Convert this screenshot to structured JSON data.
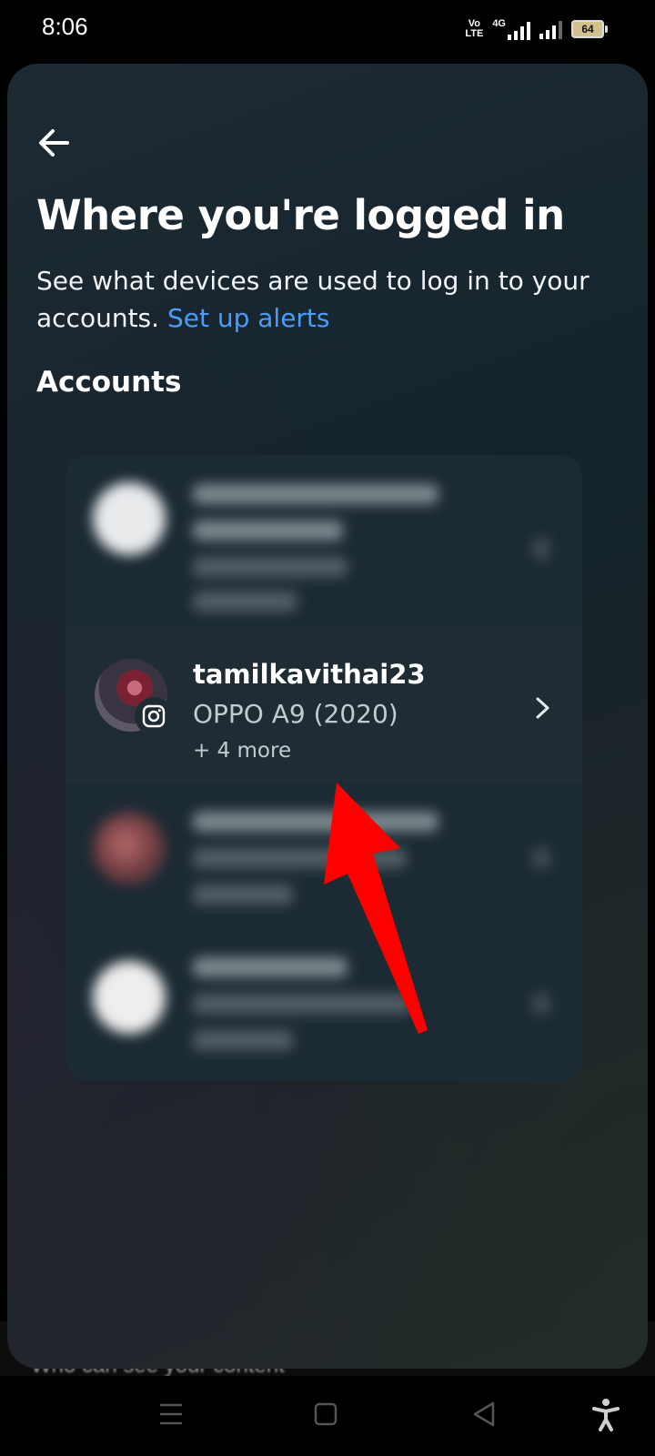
{
  "status_bar": {
    "time": "8:06",
    "volte_label": "Vo\nLTE",
    "network_label": "4G",
    "battery_level": "64"
  },
  "header": {
    "title": "Where you're logged in",
    "subtitle": "See what devices are used to log in to your accounts.",
    "alerts_link": "Set up alerts"
  },
  "accounts": {
    "heading": "Accounts",
    "highlighted": {
      "username": "tamilkavithai23",
      "device": "OPPO A9 (2020)",
      "more": "+ 4 more"
    }
  },
  "background": {
    "underlying_text": "Who can see your content"
  },
  "icons": {
    "back": "arrow-left-icon",
    "chevron": "chevron-right-icon",
    "badge": "instagram-icon",
    "nav": [
      "menu-icon",
      "home-square-icon",
      "back-triangle-icon",
      "accessibility-icon"
    ]
  },
  "colors": {
    "link": "#4a9df8",
    "annotation_arrow": "#ff0000"
  }
}
